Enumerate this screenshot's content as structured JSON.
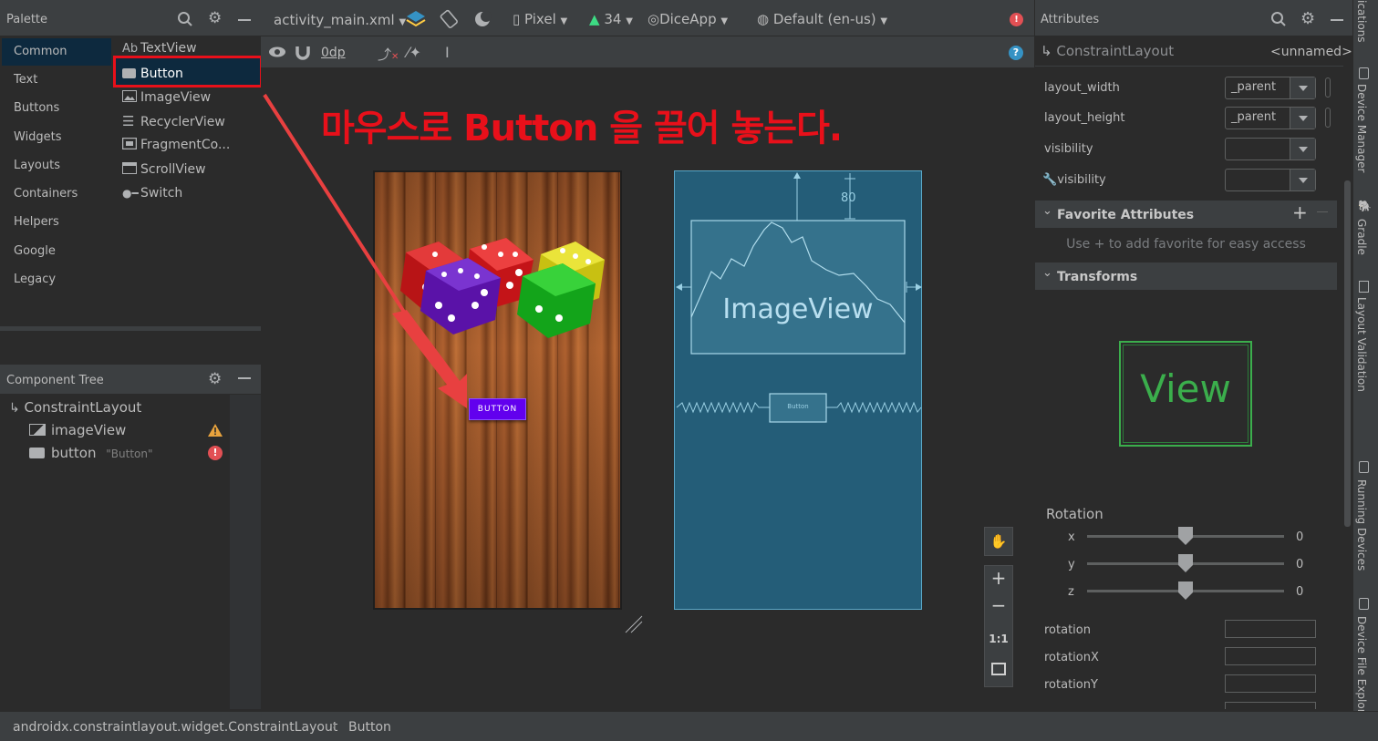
{
  "palette": {
    "title": "Palette",
    "categories": [
      "Common",
      "Text",
      "Buttons",
      "Widgets",
      "Layouts",
      "Containers",
      "Helpers",
      "Google",
      "Legacy"
    ],
    "items": [
      {
        "label": "TextView",
        "icon": "textview-icon"
      },
      {
        "label": "Button",
        "icon": "button-icon"
      },
      {
        "label": "ImageView",
        "icon": "image-icon"
      },
      {
        "label": "RecyclerView",
        "icon": "list-icon"
      },
      {
        "label": "FragmentCo...",
        "icon": "fragment-icon"
      },
      {
        "label": "ScrollView",
        "icon": "scroll-icon"
      },
      {
        "label": "Switch",
        "icon": "switch-icon"
      }
    ],
    "textview_prefix": "Ab"
  },
  "tree": {
    "title": "Component Tree",
    "root": "ConstraintLayout",
    "children": [
      {
        "label": "imageView",
        "sub": "",
        "status": "warning"
      },
      {
        "label": "button",
        "sub": "\"Button\"",
        "status": "error"
      }
    ]
  },
  "toolbar": {
    "file_tab": "activity_main.xml",
    "device": "Pixel",
    "api": "34",
    "app": "DiceApp",
    "locale": "Default (en-us)",
    "margin": "0dp"
  },
  "annotation": {
    "text": "마우스로 Button 을 끌어 놓는다.",
    "color": "#e8101a"
  },
  "design": {
    "button_label": "BUTTON",
    "button_color": "#6200ee"
  },
  "blueprint": {
    "imageview_label": "ImageView",
    "margin_label": "80",
    "button_label": "Button"
  },
  "zoom": {
    "fit_label": "1:1"
  },
  "attributes": {
    "title": "Attributes",
    "component": "ConstraintLayout",
    "id": "<unnamed>",
    "rows": [
      {
        "label": "layout_width",
        "value": "match_parent",
        "shown": "_parent"
      },
      {
        "label": "layout_height",
        "value": "match_parent",
        "shown": "_parent"
      },
      {
        "label": "visibility",
        "value": ""
      },
      {
        "label": "visibility",
        "value": ""
      }
    ],
    "favorites_title": "Favorite Attributes",
    "favorites_hint": "Use + to add favorite for easy access",
    "transforms_title": "Transforms",
    "view_label": "View",
    "rotation_title": "Rotation",
    "axes": [
      {
        "axis": "x",
        "value": "0"
      },
      {
        "axis": "y",
        "value": "0"
      },
      {
        "axis": "z",
        "value": "0"
      }
    ],
    "text_rows": [
      "rotation",
      "rotationX",
      "rotationY"
    ]
  },
  "side_tabs": [
    "ications",
    "Device Manager",
    "Gradle",
    "Layout Validation",
    "Running Devices",
    "Device File Explorer"
  ],
  "status": {
    "path": "androidx.constraintlayout.widget.ConstraintLayout",
    "leaf": "Button"
  }
}
